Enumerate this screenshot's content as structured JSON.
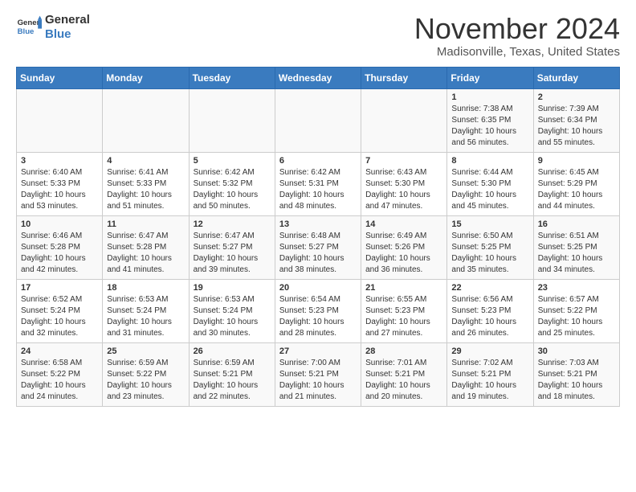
{
  "header": {
    "logo_line1": "General",
    "logo_line2": "Blue",
    "month": "November 2024",
    "location": "Madisonville, Texas, United States"
  },
  "days_of_week": [
    "Sunday",
    "Monday",
    "Tuesday",
    "Wednesday",
    "Thursday",
    "Friday",
    "Saturday"
  ],
  "weeks": [
    [
      {
        "day": "",
        "info": ""
      },
      {
        "day": "",
        "info": ""
      },
      {
        "day": "",
        "info": ""
      },
      {
        "day": "",
        "info": ""
      },
      {
        "day": "",
        "info": ""
      },
      {
        "day": "1",
        "info": "Sunrise: 7:38 AM\nSunset: 6:35 PM\nDaylight: 10 hours and 56 minutes."
      },
      {
        "day": "2",
        "info": "Sunrise: 7:39 AM\nSunset: 6:34 PM\nDaylight: 10 hours and 55 minutes."
      }
    ],
    [
      {
        "day": "3",
        "info": "Sunrise: 6:40 AM\nSunset: 5:33 PM\nDaylight: 10 hours and 53 minutes."
      },
      {
        "day": "4",
        "info": "Sunrise: 6:41 AM\nSunset: 5:33 PM\nDaylight: 10 hours and 51 minutes."
      },
      {
        "day": "5",
        "info": "Sunrise: 6:42 AM\nSunset: 5:32 PM\nDaylight: 10 hours and 50 minutes."
      },
      {
        "day": "6",
        "info": "Sunrise: 6:42 AM\nSunset: 5:31 PM\nDaylight: 10 hours and 48 minutes."
      },
      {
        "day": "7",
        "info": "Sunrise: 6:43 AM\nSunset: 5:30 PM\nDaylight: 10 hours and 47 minutes."
      },
      {
        "day": "8",
        "info": "Sunrise: 6:44 AM\nSunset: 5:30 PM\nDaylight: 10 hours and 45 minutes."
      },
      {
        "day": "9",
        "info": "Sunrise: 6:45 AM\nSunset: 5:29 PM\nDaylight: 10 hours and 44 minutes."
      }
    ],
    [
      {
        "day": "10",
        "info": "Sunrise: 6:46 AM\nSunset: 5:28 PM\nDaylight: 10 hours and 42 minutes."
      },
      {
        "day": "11",
        "info": "Sunrise: 6:47 AM\nSunset: 5:28 PM\nDaylight: 10 hours and 41 minutes."
      },
      {
        "day": "12",
        "info": "Sunrise: 6:47 AM\nSunset: 5:27 PM\nDaylight: 10 hours and 39 minutes."
      },
      {
        "day": "13",
        "info": "Sunrise: 6:48 AM\nSunset: 5:27 PM\nDaylight: 10 hours and 38 minutes."
      },
      {
        "day": "14",
        "info": "Sunrise: 6:49 AM\nSunset: 5:26 PM\nDaylight: 10 hours and 36 minutes."
      },
      {
        "day": "15",
        "info": "Sunrise: 6:50 AM\nSunset: 5:25 PM\nDaylight: 10 hours and 35 minutes."
      },
      {
        "day": "16",
        "info": "Sunrise: 6:51 AM\nSunset: 5:25 PM\nDaylight: 10 hours and 34 minutes."
      }
    ],
    [
      {
        "day": "17",
        "info": "Sunrise: 6:52 AM\nSunset: 5:24 PM\nDaylight: 10 hours and 32 minutes."
      },
      {
        "day": "18",
        "info": "Sunrise: 6:53 AM\nSunset: 5:24 PM\nDaylight: 10 hours and 31 minutes."
      },
      {
        "day": "19",
        "info": "Sunrise: 6:53 AM\nSunset: 5:24 PM\nDaylight: 10 hours and 30 minutes."
      },
      {
        "day": "20",
        "info": "Sunrise: 6:54 AM\nSunset: 5:23 PM\nDaylight: 10 hours and 28 minutes."
      },
      {
        "day": "21",
        "info": "Sunrise: 6:55 AM\nSunset: 5:23 PM\nDaylight: 10 hours and 27 minutes."
      },
      {
        "day": "22",
        "info": "Sunrise: 6:56 AM\nSunset: 5:23 PM\nDaylight: 10 hours and 26 minutes."
      },
      {
        "day": "23",
        "info": "Sunrise: 6:57 AM\nSunset: 5:22 PM\nDaylight: 10 hours and 25 minutes."
      }
    ],
    [
      {
        "day": "24",
        "info": "Sunrise: 6:58 AM\nSunset: 5:22 PM\nDaylight: 10 hours and 24 minutes."
      },
      {
        "day": "25",
        "info": "Sunrise: 6:59 AM\nSunset: 5:22 PM\nDaylight: 10 hours and 23 minutes."
      },
      {
        "day": "26",
        "info": "Sunrise: 6:59 AM\nSunset: 5:21 PM\nDaylight: 10 hours and 22 minutes."
      },
      {
        "day": "27",
        "info": "Sunrise: 7:00 AM\nSunset: 5:21 PM\nDaylight: 10 hours and 21 minutes."
      },
      {
        "day": "28",
        "info": "Sunrise: 7:01 AM\nSunset: 5:21 PM\nDaylight: 10 hours and 20 minutes."
      },
      {
        "day": "29",
        "info": "Sunrise: 7:02 AM\nSunset: 5:21 PM\nDaylight: 10 hours and 19 minutes."
      },
      {
        "day": "30",
        "info": "Sunrise: 7:03 AM\nSunset: 5:21 PM\nDaylight: 10 hours and 18 minutes."
      }
    ]
  ]
}
